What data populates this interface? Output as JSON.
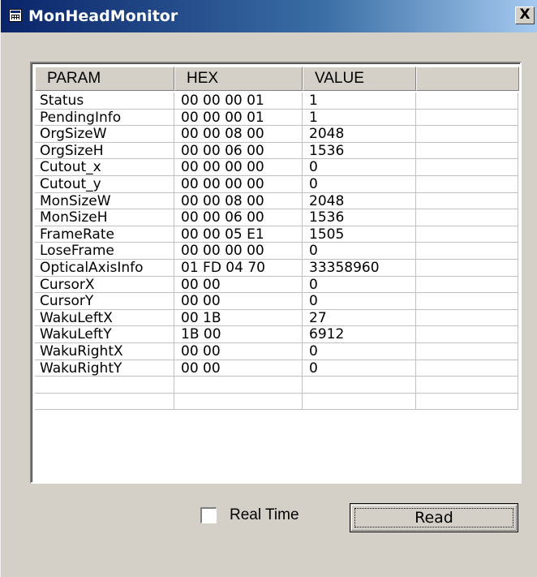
{
  "window": {
    "title": "MonHeadMonitor",
    "close_label": "X"
  },
  "table": {
    "headers": [
      "PARAM",
      "HEX",
      "VALUE",
      ""
    ],
    "rows": [
      [
        "Status",
        "00 00 00 01",
        "1",
        ""
      ],
      [
        "PendingInfo",
        "00 00 00 01",
        "1",
        ""
      ],
      [
        "OrgSizeW",
        "00 00 08 00",
        "2048",
        ""
      ],
      [
        "OrgSizeH",
        "00 00 06 00",
        "1536",
        ""
      ],
      [
        "Cutout_x",
        "00 00 00 00",
        "0",
        ""
      ],
      [
        "Cutout_y",
        "00 00 00 00",
        "0",
        ""
      ],
      [
        "MonSizeW",
        "00 00 08 00",
        "2048",
        ""
      ],
      [
        "MonSizeH",
        "00 00 06 00",
        "1536",
        ""
      ],
      [
        "FrameRate",
        "00 00 05 E1",
        "1505",
        ""
      ],
      [
        "LoseFrame",
        "00 00 00 00",
        "0",
        ""
      ],
      [
        "OpticalAxisInfo",
        "01 FD 04 70",
        "33358960",
        ""
      ],
      [
        "CursorX",
        "00 00",
        "0",
        ""
      ],
      [
        "CursorY",
        "00 00",
        "0",
        ""
      ],
      [
        "WakuLeftX",
        "00 1B",
        "27",
        ""
      ],
      [
        "WakuLeftY",
        "1B 00",
        "6912",
        ""
      ],
      [
        "WakuRightX",
        "00 00",
        "0",
        ""
      ],
      [
        "WakuRightY",
        "00 00",
        "0",
        ""
      ],
      [
        "",
        "",
        "",
        ""
      ],
      [
        "",
        "",
        "",
        ""
      ]
    ]
  },
  "controls": {
    "realtime_label": "Real Time",
    "realtime_checked": false,
    "read_label": "Read"
  }
}
